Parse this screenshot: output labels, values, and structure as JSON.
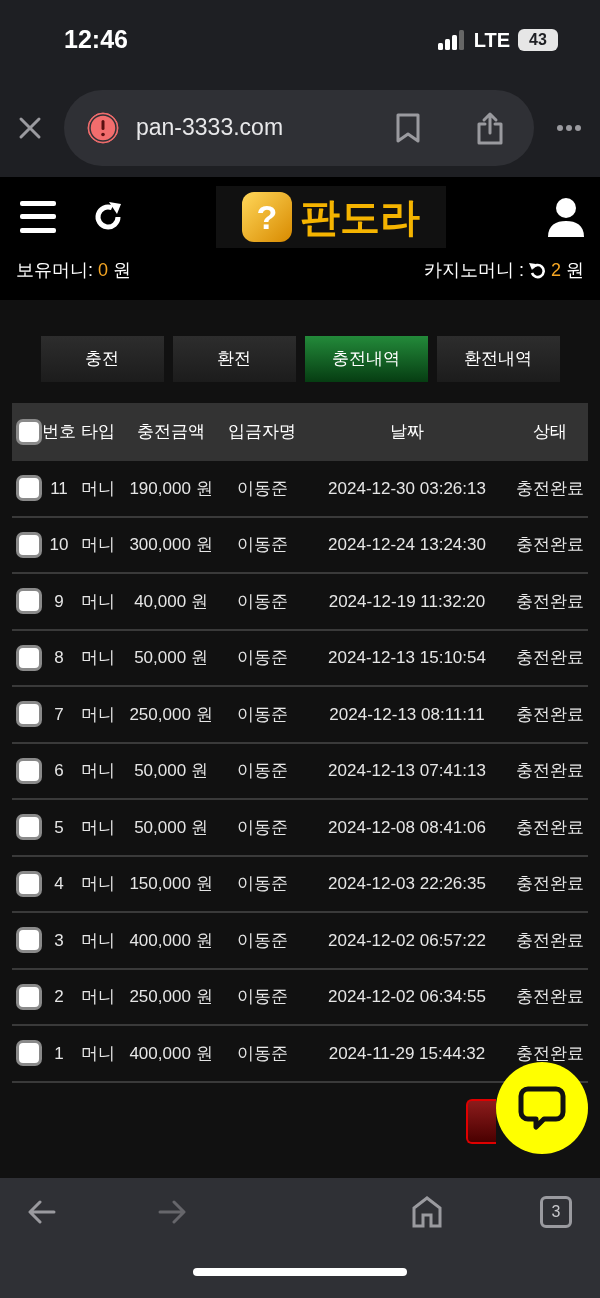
{
  "status_bar": {
    "time": "12:46",
    "network": "LTE",
    "battery": "43"
  },
  "browser": {
    "url": "pan-3333.com",
    "tab_count": "3"
  },
  "header": {
    "logo_mark": "?",
    "logo_text": "판도라"
  },
  "balances": [
    {
      "label": "보유머니:",
      "value": "0",
      "unit": "원",
      "refresh": false
    },
    {
      "label": "카지노머니 :",
      "value": "2",
      "unit": "원",
      "refresh": true
    }
  ],
  "tabs": [
    {
      "label": "충전",
      "selected": false
    },
    {
      "label": "환전",
      "selected": false
    },
    {
      "label": "충전내역",
      "selected": true
    },
    {
      "label": "환전내역",
      "selected": false
    }
  ],
  "table": {
    "select_all_checked": false,
    "columns": [
      "번호",
      "타입",
      "충전금액",
      "입금자명",
      "날짜",
      "상태"
    ],
    "rows": [
      {
        "checked": false,
        "cells": [
          "11",
          "머니",
          "190,000 원",
          "이동준",
          "2024-12-30 03:26:13",
          "충전완료"
        ]
      },
      {
        "checked": false,
        "cells": [
          "10",
          "머니",
          "300,000 원",
          "이동준",
          "2024-12-24 13:24:30",
          "충전완료"
        ]
      },
      {
        "checked": false,
        "cells": [
          "9",
          "머니",
          "40,000 원",
          "이동준",
          "2024-12-19 11:32:20",
          "충전완료"
        ]
      },
      {
        "checked": false,
        "cells": [
          "8",
          "머니",
          "50,000 원",
          "이동준",
          "2024-12-13 15:10:54",
          "충전완료"
        ]
      },
      {
        "checked": false,
        "cells": [
          "7",
          "머니",
          "250,000 원",
          "이동준",
          "2024-12-13 08:11:11",
          "충전완료"
        ]
      },
      {
        "checked": false,
        "cells": [
          "6",
          "머니",
          "50,000 원",
          "이동준",
          "2024-12-13 07:41:13",
          "충전완료"
        ]
      },
      {
        "checked": false,
        "cells": [
          "5",
          "머니",
          "50,000 원",
          "이동준",
          "2024-12-08 08:41:06",
          "충전완료"
        ]
      },
      {
        "checked": false,
        "cells": [
          "4",
          "머니",
          "150,000 원",
          "이동준",
          "2024-12-03 22:26:35",
          "충전완료"
        ]
      },
      {
        "checked": false,
        "cells": [
          "3",
          "머니",
          "400,000 원",
          "이동준",
          "2024-12-02 06:57:22",
          "충전완료"
        ]
      },
      {
        "checked": false,
        "cells": [
          "2",
          "머니",
          "250,000 원",
          "이동준",
          "2024-12-02 06:34:55",
          "충전완료"
        ]
      },
      {
        "checked": false,
        "cells": [
          "1",
          "머니",
          "400,000 원",
          "이동준",
          "2024-11-29 15:44:32",
          "충전완료"
        ]
      }
    ]
  }
}
